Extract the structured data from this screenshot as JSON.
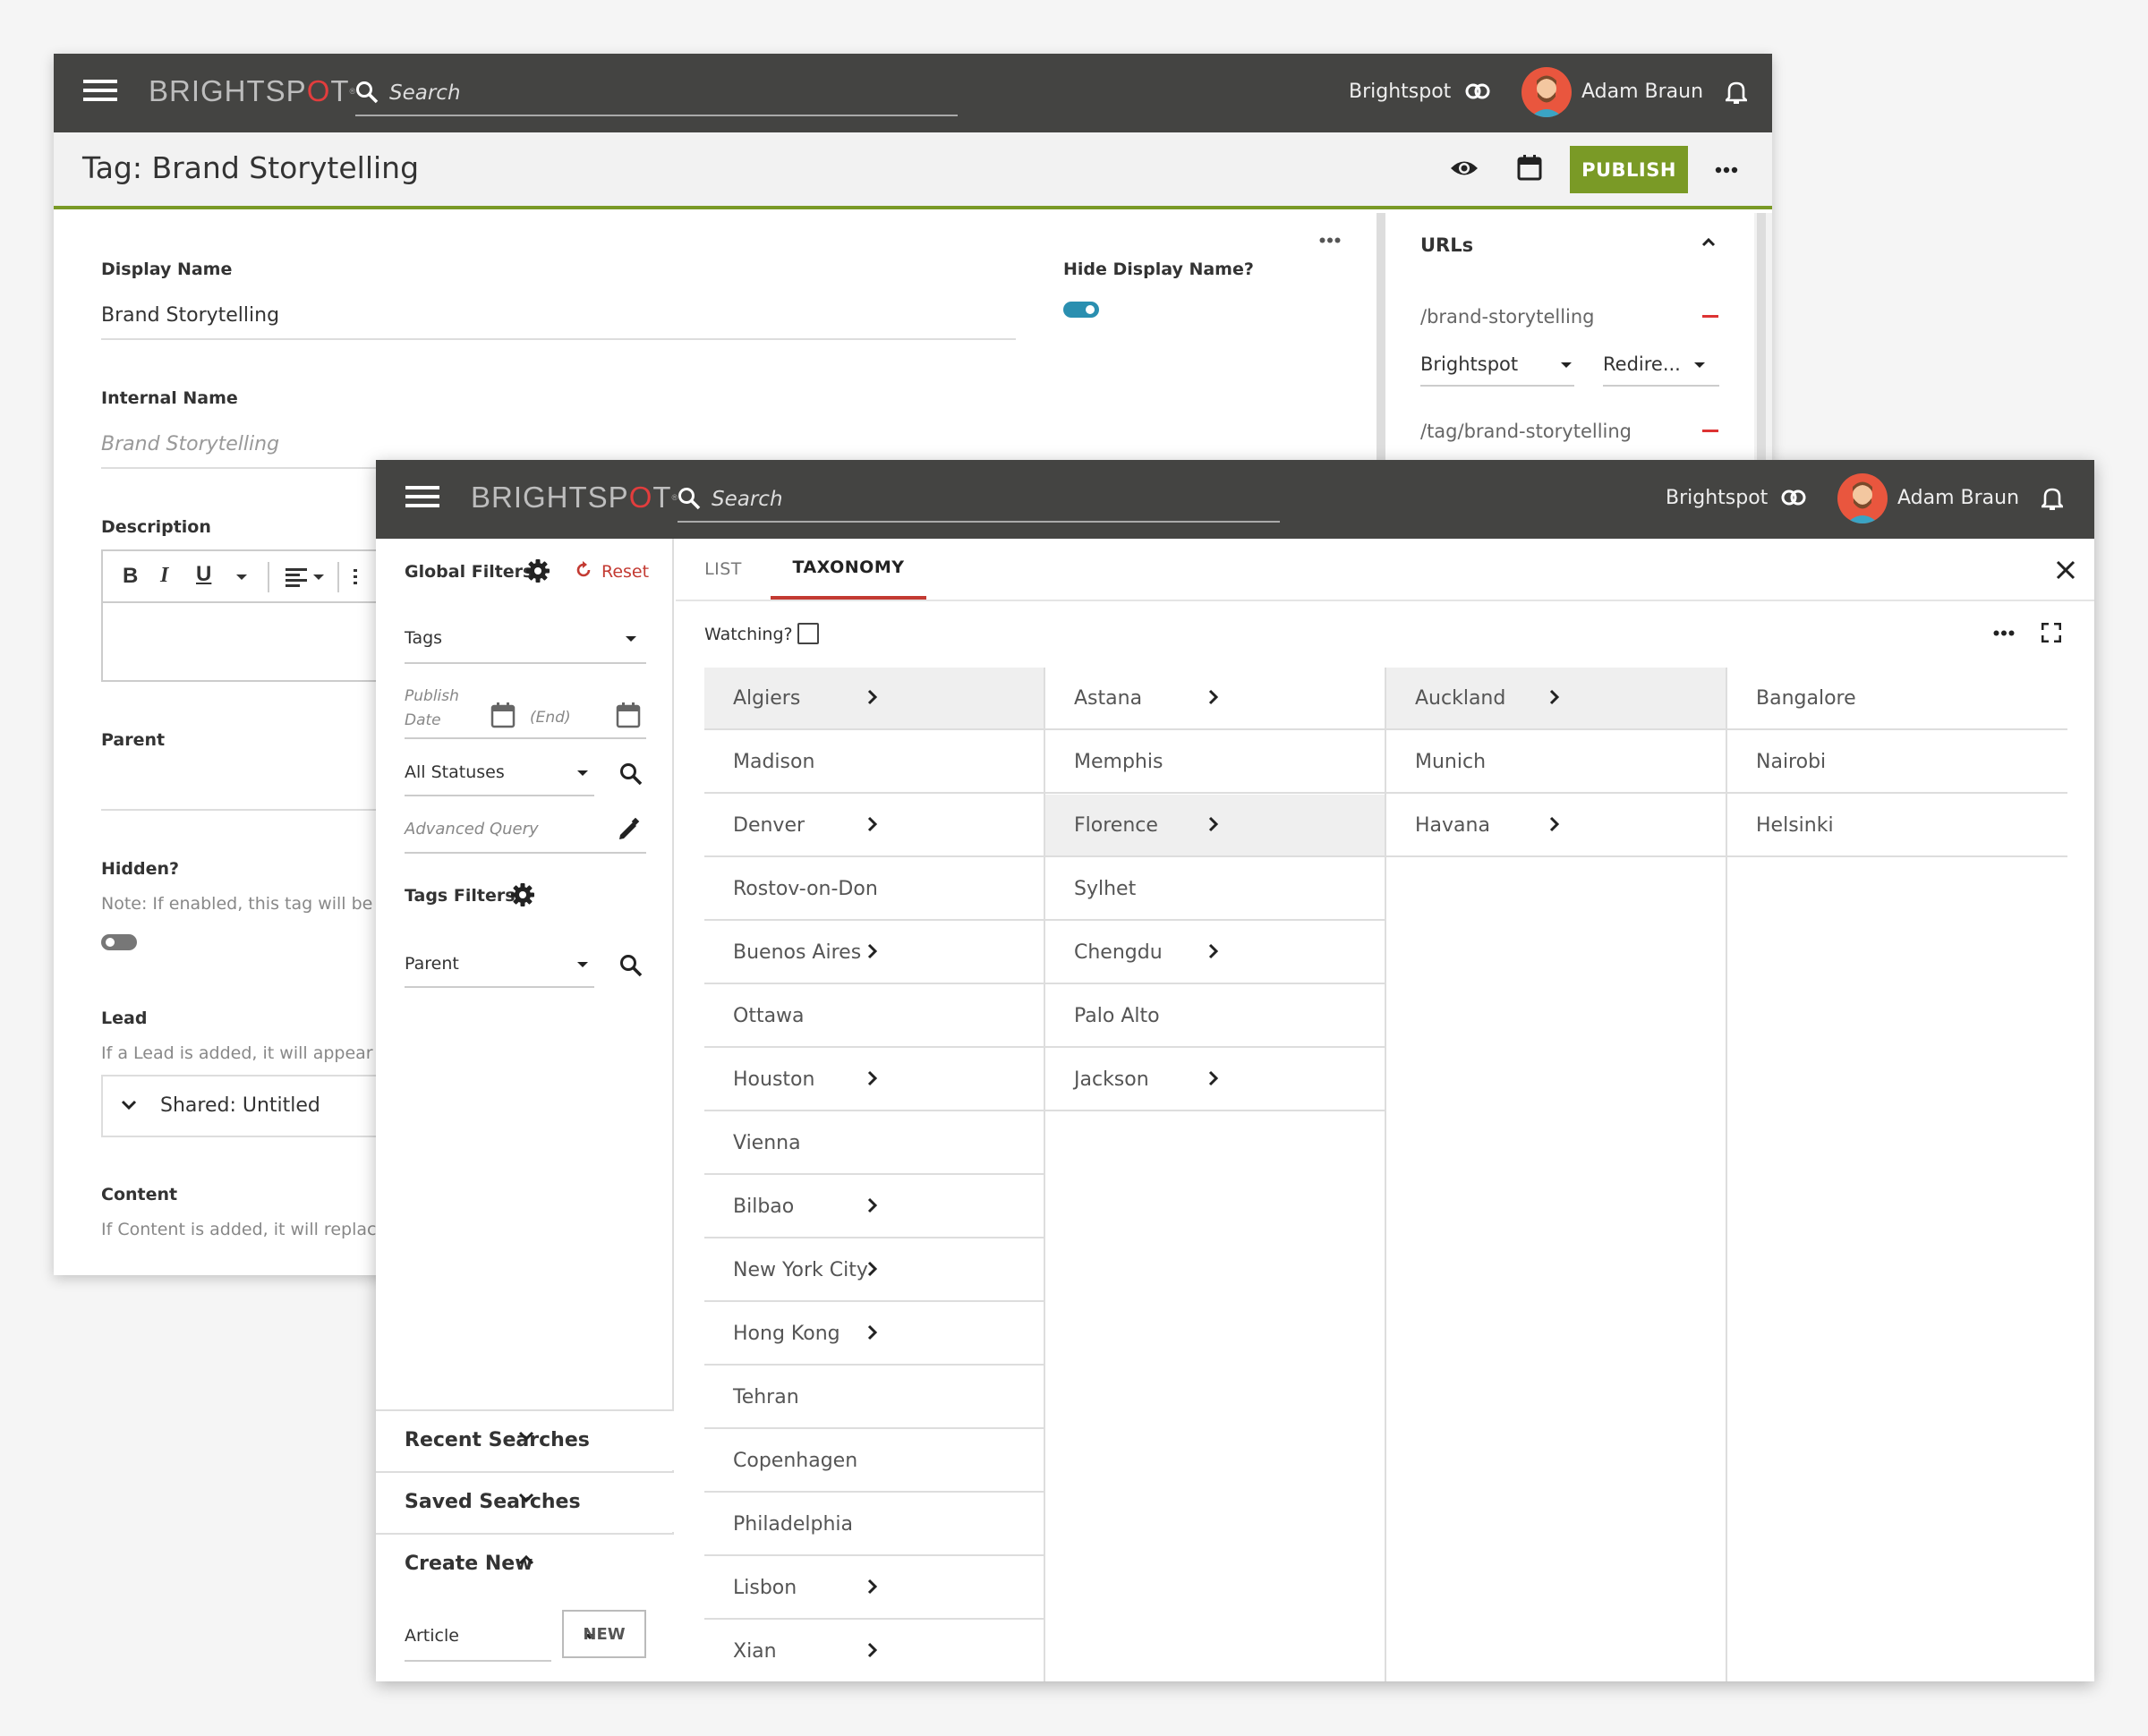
{
  "back": {
    "brand": "BRIGHTSPOT",
    "search_placeholder": "Search",
    "site": "Brightspot",
    "user": "Adam Braun",
    "page_title": "Tag: Brand Storytelling",
    "publish_label": "PUBLISH",
    "display_name_label": "Display Name",
    "display_name_value": "Brand Storytelling",
    "hide_display_name_label": "Hide Display Name?",
    "internal_name_label": "Internal Name",
    "internal_name_placeholder": "Brand Storytelling",
    "description_label": "Description",
    "parent_label": "Parent",
    "hidden_label": "Hidden?",
    "hidden_note": "Note: If enabled, this tag will be hic",
    "lead_label": "Lead",
    "lead_note": "If a Lead is added, it will appear bel",
    "lead_value": "Shared: Untitled",
    "content_label": "Content",
    "content_note": "If Content is added, it will replace tl",
    "urls": {
      "title": "URLs",
      "items": [
        "/brand-storytelling",
        "/tag/brand-storytelling"
      ],
      "site_select": "Brightspot",
      "type_select": "Redire..."
    }
  },
  "front": {
    "brand": "BRIGHTSPOT",
    "search_placeholder": "Search",
    "site": "Brightspot",
    "user": "Adam Braun",
    "global_filters_label": "Global Filters",
    "reset_label": "Reset",
    "type_select": "Tags",
    "publish_date_label": "Publish Date",
    "end_label": "(End)",
    "status_select": "All Statuses",
    "advanced_query_placeholder": "Advanced Query",
    "tags_filters_label": "Tags Filters",
    "parent_select": "Parent",
    "recent_searches": "Recent Searches",
    "saved_searches": "Saved Searches",
    "create_new": "Create New",
    "create_type": "Article",
    "new_label": "NEW",
    "tabs": [
      "LIST",
      "TAXONOMY"
    ],
    "active_tab": "TAXONOMY",
    "watching_label": "Watching?",
    "columns": [
      [
        {
          "name": "Algiers",
          "children": true,
          "selected": true
        },
        {
          "name": "Madison",
          "children": false
        },
        {
          "name": "Denver",
          "children": true
        },
        {
          "name": "Rostov-on-Don",
          "children": false
        },
        {
          "name": "Buenos Aires",
          "children": true
        },
        {
          "name": "Ottawa",
          "children": false
        },
        {
          "name": "Houston",
          "children": true
        },
        {
          "name": "Vienna",
          "children": false
        },
        {
          "name": "Bilbao",
          "children": true
        },
        {
          "name": "New York City",
          "children": true
        },
        {
          "name": "Hong Kong",
          "children": true
        },
        {
          "name": "Tehran",
          "children": false
        },
        {
          "name": "Copenhagen",
          "children": false
        },
        {
          "name": "Philadelphia",
          "children": false
        },
        {
          "name": "Lisbon",
          "children": true
        },
        {
          "name": "Xian",
          "children": true
        }
      ],
      [
        {
          "name": "Astana",
          "children": true
        },
        {
          "name": "Memphis",
          "children": false
        },
        {
          "name": "Florence",
          "children": true,
          "selected": true
        },
        {
          "name": "Sylhet",
          "children": false
        },
        {
          "name": "Chengdu",
          "children": true
        },
        {
          "name": "Palo Alto",
          "children": false
        },
        {
          "name": "Jackson",
          "children": true
        }
      ],
      [
        {
          "name": "Auckland",
          "children": true,
          "selected": true
        },
        {
          "name": "Munich",
          "children": false
        },
        {
          "name": "Havana",
          "children": true
        }
      ],
      [
        {
          "name": "Bangalore",
          "children": false
        },
        {
          "name": "Nairobi",
          "children": false
        },
        {
          "name": "Helsinki",
          "children": false
        }
      ]
    ]
  },
  "colors": {
    "topbar": "#444442",
    "publish": "#7a9a26",
    "tab_accent": "#c33a32",
    "toggle_on": "#2a8fb0"
  }
}
